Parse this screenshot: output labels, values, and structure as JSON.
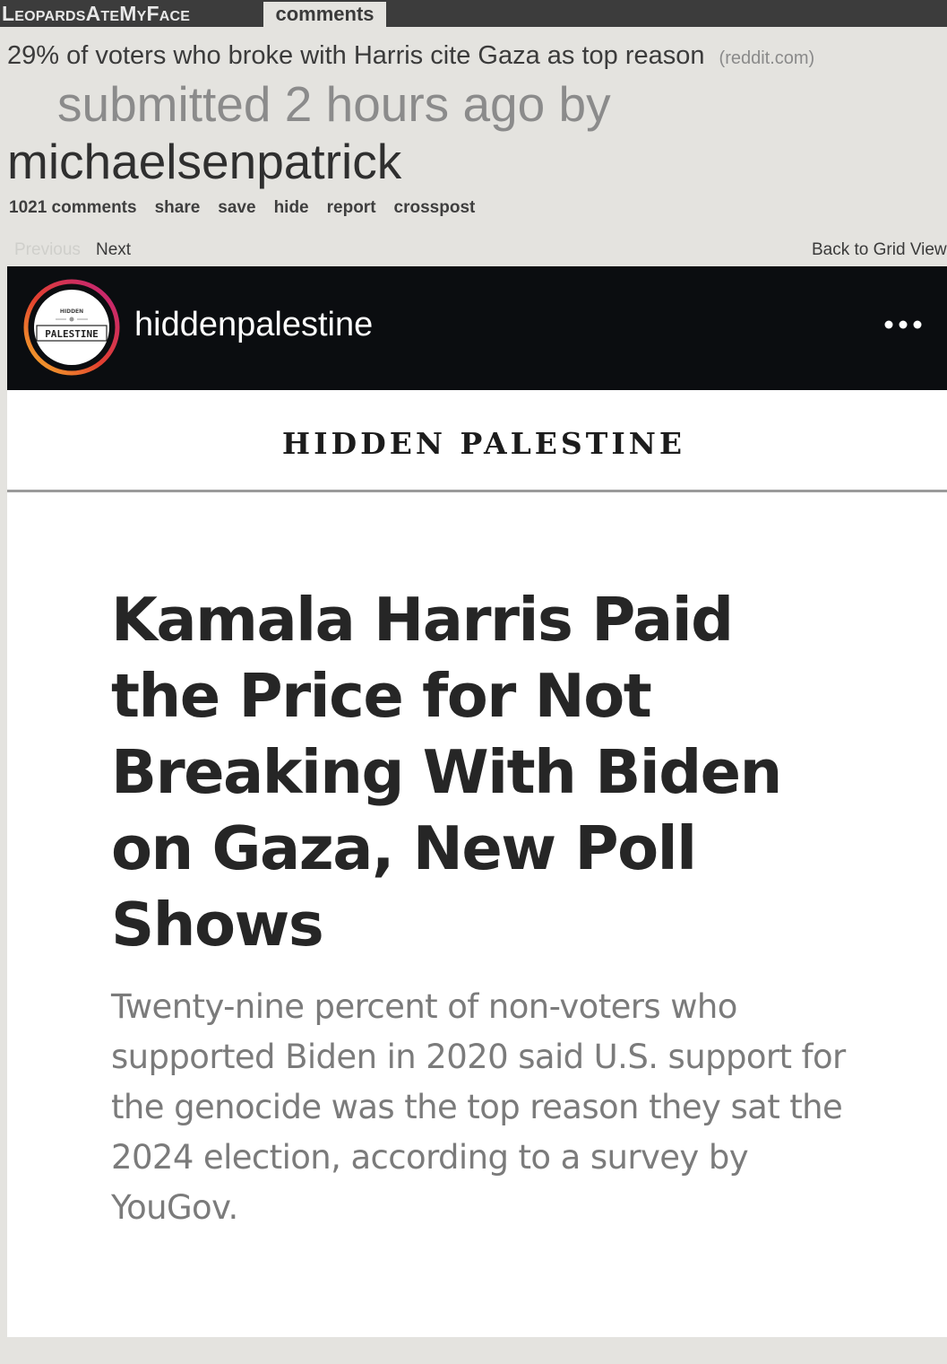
{
  "header": {
    "subreddit": "LeopardsAteMyFace",
    "active_tab": "comments"
  },
  "post": {
    "title": "29% of voters who broke with Harris cite Gaza as top reason",
    "domain": "(reddit.com)",
    "submitted": "submitted 2 hours ago by",
    "author": "michaelsenpatrick",
    "actions": [
      "1021 comments",
      "share",
      "save",
      "hide",
      "report",
      "crosspost"
    ]
  },
  "gallery_nav": {
    "previous": "Previous",
    "next": "Next",
    "back": "Back to Grid View"
  },
  "embed": {
    "ig_username": "hiddenpalestine",
    "avatar_text_top": "HIDDEN",
    "avatar_text_main": "PALESTINE",
    "masthead": "HIDDEN PALESTINE",
    "headline": "Kamala Harris Paid the Price for Not Breaking With Biden on Gaza, New Poll Shows",
    "dek": "Twenty-nine percent of non-voters who supported Biden in 2020 said U.S. support for the genocide was the top reason they sat the 2024 election, according to a survey by YouGov."
  },
  "colors": {
    "page_bg": "#e4e3df",
    "topbar_bg": "#3c3c3c",
    "ig_header_bg": "#0b0d10",
    "headline": "#262626",
    "dek": "#7b7b7b"
  },
  "icons": {
    "more": "more-horizontal-icon",
    "avatar_ring": "story-ring-icon"
  }
}
